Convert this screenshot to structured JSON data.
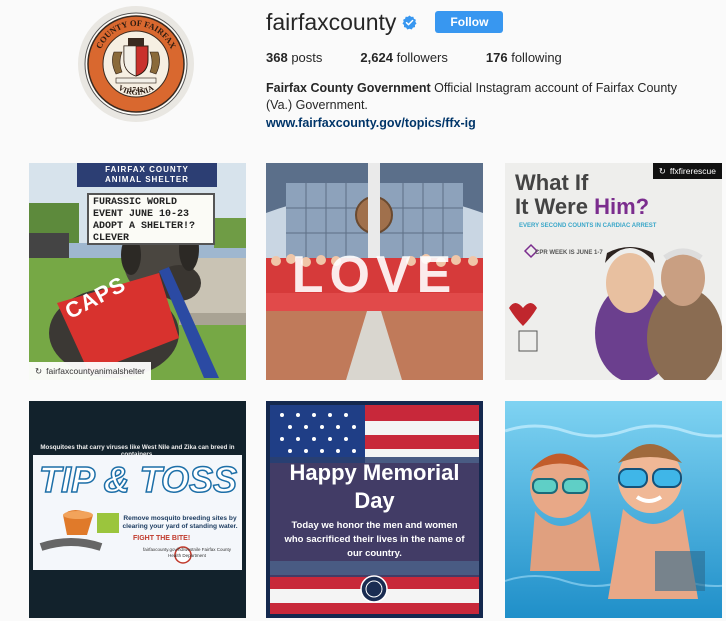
{
  "profile": {
    "username": "fairfaxcounty",
    "verified": true,
    "follow_label": "Follow",
    "stats": {
      "posts_count": "368",
      "posts_label": "posts",
      "followers_count": "2,624",
      "followers_label": "followers",
      "following_count": "176",
      "following_label": "following"
    },
    "full_name": "Fairfax County Government",
    "bio": " Official Instagram account of Fairfax County (Va.) Government.",
    "link": "www.fairfaxcounty.gov/topics/ffx-ig",
    "avatar_seal": {
      "top_text": "COUNTY OF FAIRFAX",
      "bottom_text": "VIRGINIA",
      "year": "1742"
    }
  },
  "colors": {
    "accent": "#3897f0",
    "link": "#003569",
    "seal_orange": "#d9682f",
    "background": "#fafafa"
  },
  "posts": [
    {
      "sign_title": "FAIRFAX COUNTY",
      "sign_subtitle": "ANIMAL SHELTER",
      "board_text": "FURASSIC WORLD\nEVENT JUNE 10-23\nADOPT A SHELTER!?\nCLEVER",
      "vest_text": "CAPS",
      "repost_handle": "fairfaxcountyanimalshelter"
    },
    {
      "sculpture_text": "LOVE"
    },
    {
      "repost_handle": "ffxfirerescue",
      "headline_line1": "What If",
      "headline_line2_start": "It Were ",
      "headline_emphasis": "Him?",
      "subline": "EVERY SECOND COUNTS IN CARDIAC ARREST",
      "cpr_week": "CPR WEEK IS JUNE 1-7"
    },
    {
      "note": "Mosquitoes that carry viruses like West Nile and Zika can breed in containers.",
      "title": "TIP & TOSS",
      "remove_text": "Remove mosquito breeding sites by clearing your yard of standing water.",
      "fight_text": "FIGHT THE BITE!",
      "site_text": "fairfaxcounty.gov/hd/westnile Fairfax County Health Department"
    },
    {
      "title_line1": "Happy Memorial",
      "title_line2": "Day",
      "message": "Today we honor the men and women who sacrificed their lives in the name of our country."
    },
    {}
  ]
}
